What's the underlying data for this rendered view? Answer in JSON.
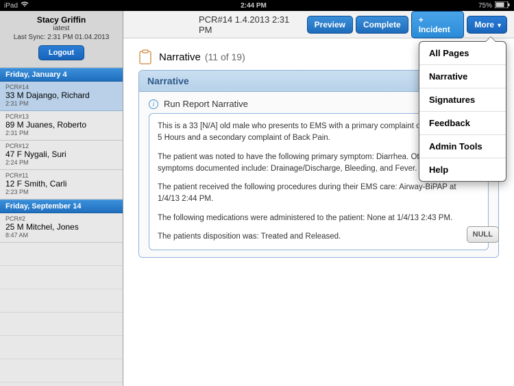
{
  "status_bar": {
    "device": "iPad",
    "time": "2:44 PM",
    "battery": "75%"
  },
  "sidebar": {
    "user_name": "Stacy  Griffin",
    "user_sub": "iatest",
    "last_sync": "Last Sync: 2:31 PM 01.04.2013",
    "logout_label": "Logout",
    "sections": [
      {
        "date_label": "Friday, January 4",
        "items": [
          {
            "id": "PCR#14",
            "main": "33 M Dajango, Richard",
            "time": "2:31 PM",
            "selected": true
          },
          {
            "id": "PCR#13",
            "main": "89 M Juanes, Roberto",
            "time": "2:31 PM",
            "selected": false
          },
          {
            "id": "PCR#12",
            "main": "47 F  Nygali, Suri",
            "time": "2:24 PM",
            "selected": false
          },
          {
            "id": "PCR#11",
            "main": "12 F  Smith, Carli",
            "time": "2:23 PM",
            "selected": false
          }
        ]
      },
      {
        "date_label": "Friday, September 14",
        "items": [
          {
            "id": "PCR#2",
            "main": "25 M Mitchel, Jones",
            "time": "8:47 AM",
            "selected": false
          }
        ]
      }
    ]
  },
  "toolbar": {
    "doc_id": "PCR#14  1.4.2013  2:31 PM",
    "preview_label": "Preview",
    "complete_label": "Complete",
    "incident_label": "+ Incident",
    "more_label": "More"
  },
  "dropdown": {
    "items": [
      "All Pages",
      "Narrative",
      "Signatures",
      "Feedback",
      "Admin Tools",
      "Help"
    ]
  },
  "section": {
    "title": "Narrative",
    "count": "(11 of 19)",
    "header": "Narrative",
    "rr_title": "Run Report Narrative",
    "para1": "This is a 33 [N/A] old male who presents to EMS with a primary complaint of Abd…  the last 5 Hours and a secondary complaint of Back Pain.",
    "para2": "The patient was noted to have the following primary symptom: Diarrhea. Other a… symptoms documented include: Drainage/Discharge, Bleeding, and Fever.",
    "para3": "The patient received the following procedures during their EMS care: Airway-BiPAP at 1/4/13 2:44 PM.",
    "para4": "The following medications were administered to the patient: None at 1/4/13 2:43 PM.",
    "para5": "The patients disposition was: Treated and Released.",
    "null_label": "NULL"
  }
}
